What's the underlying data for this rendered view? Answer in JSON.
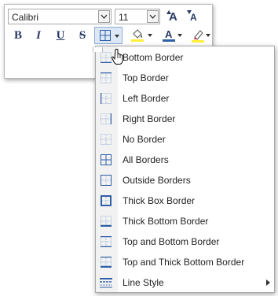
{
  "toolbar": {
    "font_name": "Calibri",
    "font_size": "11",
    "bold_label": "B",
    "italic_label": "I",
    "underline_label": "U",
    "strike_label": "S",
    "font_color_label": "A",
    "grow_font_label": "A",
    "shrink_font_label": "A"
  },
  "menu": {
    "items": [
      {
        "label": "Bottom Border",
        "icon": "bottom-border-icon"
      },
      {
        "label": "Top Border",
        "icon": "top-border-icon"
      },
      {
        "label": "Left Border",
        "icon": "left-border-icon"
      },
      {
        "label": "Right Border",
        "icon": "right-border-icon"
      },
      {
        "label": "No Border",
        "icon": "no-border-icon"
      },
      {
        "label": "All Borders",
        "icon": "all-borders-icon"
      },
      {
        "label": "Outside Borders",
        "icon": "outside-borders-icon"
      },
      {
        "label": "Thick Box Border",
        "icon": "thick-box-border-icon"
      },
      {
        "label": "Thick Bottom Border",
        "icon": "thick-bottom-border-icon"
      },
      {
        "label": "Top and Bottom Border",
        "icon": "top-bottom-border-icon"
      },
      {
        "label": "Top and Thick Bottom Border",
        "icon": "top-thick-bottom-border-icon"
      },
      {
        "label": "Line Style",
        "icon": "line-style-icon",
        "has_submenu": true
      }
    ]
  },
  "colors": {
    "icon_blue": "#2f5fa6",
    "font_color_bar": "#2f5fa6",
    "highlight_bar": "#ffef3a"
  }
}
